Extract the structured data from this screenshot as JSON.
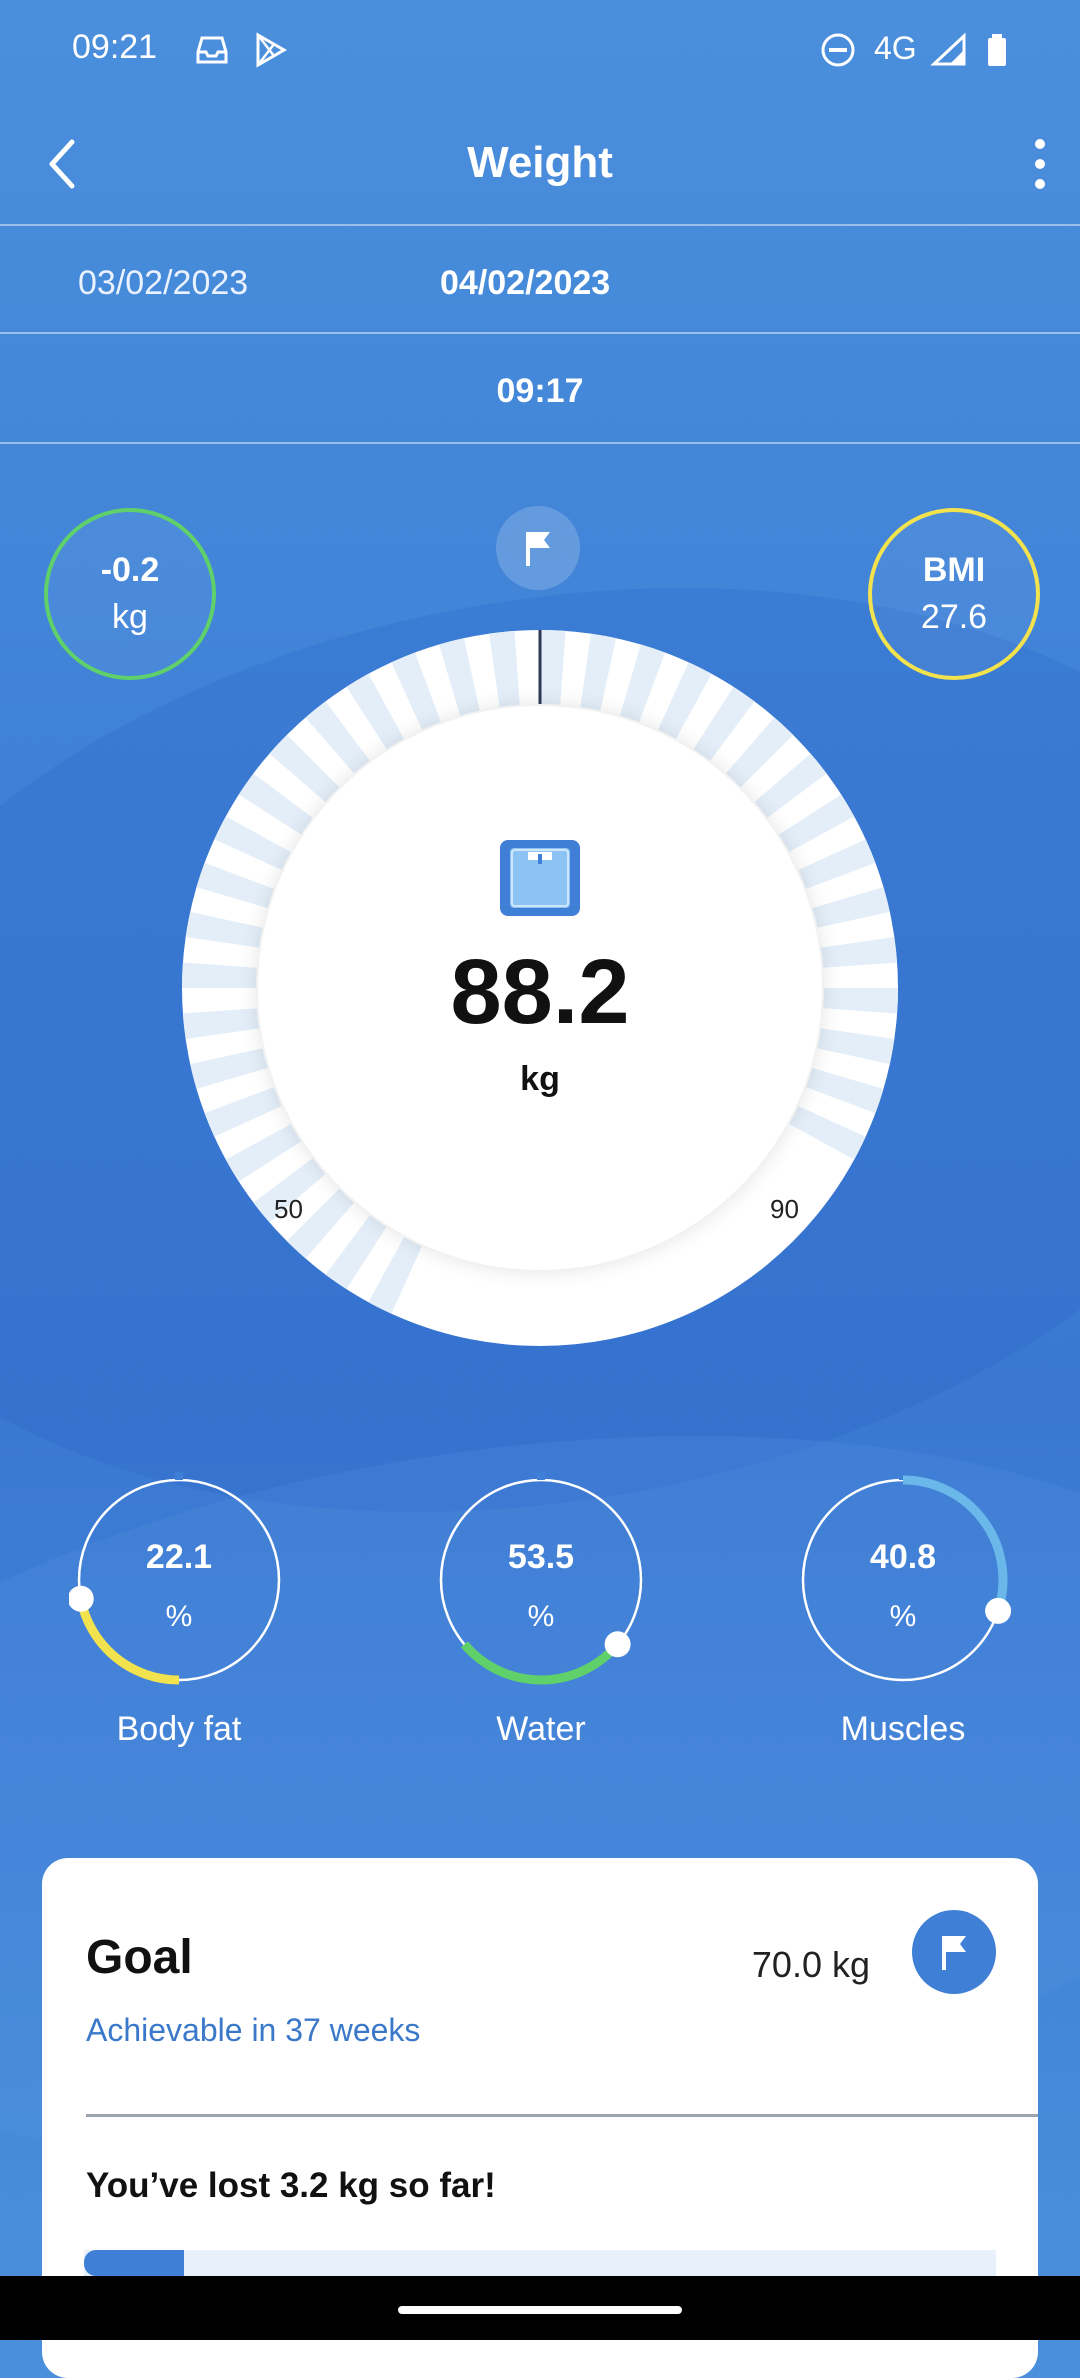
{
  "status_bar": {
    "time": "09:21",
    "network": "4G"
  },
  "header": {
    "title": "Weight"
  },
  "dates": {
    "previous": "03/02/2023",
    "current": "04/02/2023",
    "time": "09:17"
  },
  "difference": {
    "value": "-0.2",
    "unit": "kg"
  },
  "bmi": {
    "label": "BMI",
    "value": "27.6"
  },
  "gauge": {
    "value": "88.2",
    "unit": "kg",
    "min_label": "50",
    "max_label": "90"
  },
  "metrics": [
    {
      "value": "22.1",
      "unit": "%",
      "label": "Body fat",
      "color": "#f2e24e",
      "fraction": 0.22
    },
    {
      "value": "53.5",
      "unit": "%",
      "label": "Water",
      "color": "#5fd06a",
      "fraction": 0.28
    },
    {
      "value": "40.8",
      "unit": "%",
      "label": "Muscles",
      "color": "#6ab8ea",
      "fraction": 0.3
    }
  ],
  "goal": {
    "title": "Goal",
    "value": "70.0 kg",
    "subtitle": "Achievable in 37 weeks",
    "progress_text": "You’ve lost 3.2 kg so far!",
    "progress_fraction": 0.11
  },
  "colors": {
    "accent": "#3f80d6",
    "diff_ring": "#5fd06a",
    "bmi_ring": "#f2e24e"
  }
}
